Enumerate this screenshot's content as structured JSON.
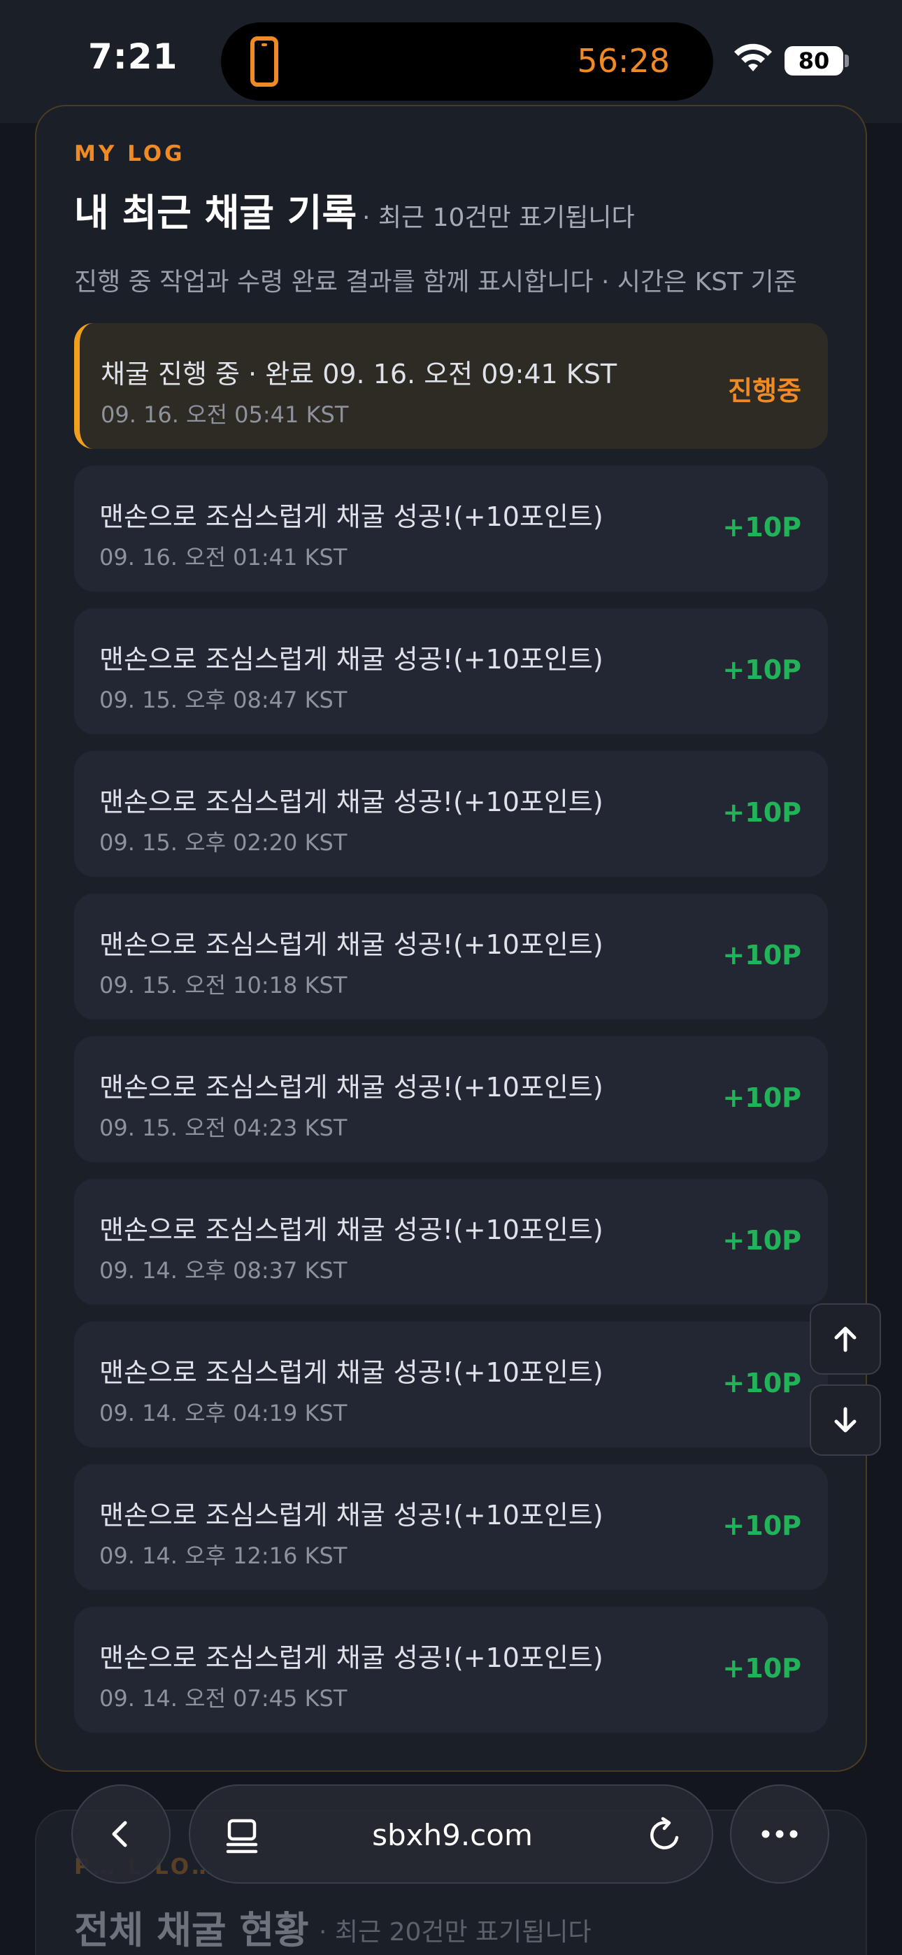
{
  "status_bar": {
    "time": "7:21",
    "activity_timer": "56:28",
    "battery": "80",
    "icons": [
      "phone-icon",
      "wifi-icon",
      "battery-icon"
    ]
  },
  "my_log": {
    "eyebrow": "MY LOG",
    "title": "내 최근 채굴 기록",
    "title_note": "· 최근 10건만 표기됩니다",
    "subtitle": "진행 중 작업과 수령 완료 결과를 함께 표시합니다 · 시간은 KST 기준",
    "items": [
      {
        "text": "채굴 진행 중 · 완료 09. 16. 오전 09:41 KST",
        "time": "09. 16. 오전 05:41 KST",
        "badge": "진행중",
        "status": "active"
      },
      {
        "text": "맨손으로 조심스럽게 채굴 성공!(+10포인트)",
        "time": "09. 16. 오전 01:41 KST",
        "badge": "+10P",
        "status": "done"
      },
      {
        "text": "맨손으로 조심스럽게 채굴 성공!(+10포인트)",
        "time": "09. 15. 오후 08:47 KST",
        "badge": "+10P",
        "status": "done"
      },
      {
        "text": "맨손으로 조심스럽게 채굴 성공!(+10포인트)",
        "time": "09. 15. 오후 02:20 KST",
        "badge": "+10P",
        "status": "done"
      },
      {
        "text": "맨손으로 조심스럽게 채굴 성공!(+10포인트)",
        "time": "09. 15. 오전 10:18 KST",
        "badge": "+10P",
        "status": "done"
      },
      {
        "text": "맨손으로 조심스럽게 채굴 성공!(+10포인트)",
        "time": "09. 15. 오전 04:23 KST",
        "badge": "+10P",
        "status": "done"
      },
      {
        "text": "맨손으로 조심스럽게 채굴 성공!(+10포인트)",
        "time": "09. 14. 오후 08:37 KST",
        "badge": "+10P",
        "status": "done"
      },
      {
        "text": "맨손으로 조심스럽게 채굴 성공!(+10포인트)",
        "time": "09. 14. 오후 04:19 KST",
        "badge": "+10P",
        "status": "done"
      },
      {
        "text": "맨손으로 조심스럽게 채굴 성공!(+10포인트)",
        "time": "09. 14. 오후 12:16 KST",
        "badge": "+10P",
        "status": "done"
      },
      {
        "text": "맨손으로 조심스럽게 채굴 성공!(+10포인트)",
        "time": "09. 14. 오전 07:45 KST",
        "badge": "+10P",
        "status": "done"
      }
    ]
  },
  "total_log": {
    "eyebrow": "P… L LO…",
    "title": "전체 채굴 현황",
    "title_note": "· 최근 20건만 표기됩니다"
  },
  "browser": {
    "url": "sbxh9.com",
    "icons": [
      "back-icon",
      "tabs-icon",
      "reload-icon",
      "more-icon"
    ]
  },
  "scroll_controls": {
    "icons": [
      "arrow-up-icon",
      "arrow-down-icon"
    ]
  },
  "colors": {
    "accent": "#f08a24",
    "success": "#22b35a",
    "background": "#14161d",
    "card": "#1b1f28",
    "item": "#232733"
  }
}
